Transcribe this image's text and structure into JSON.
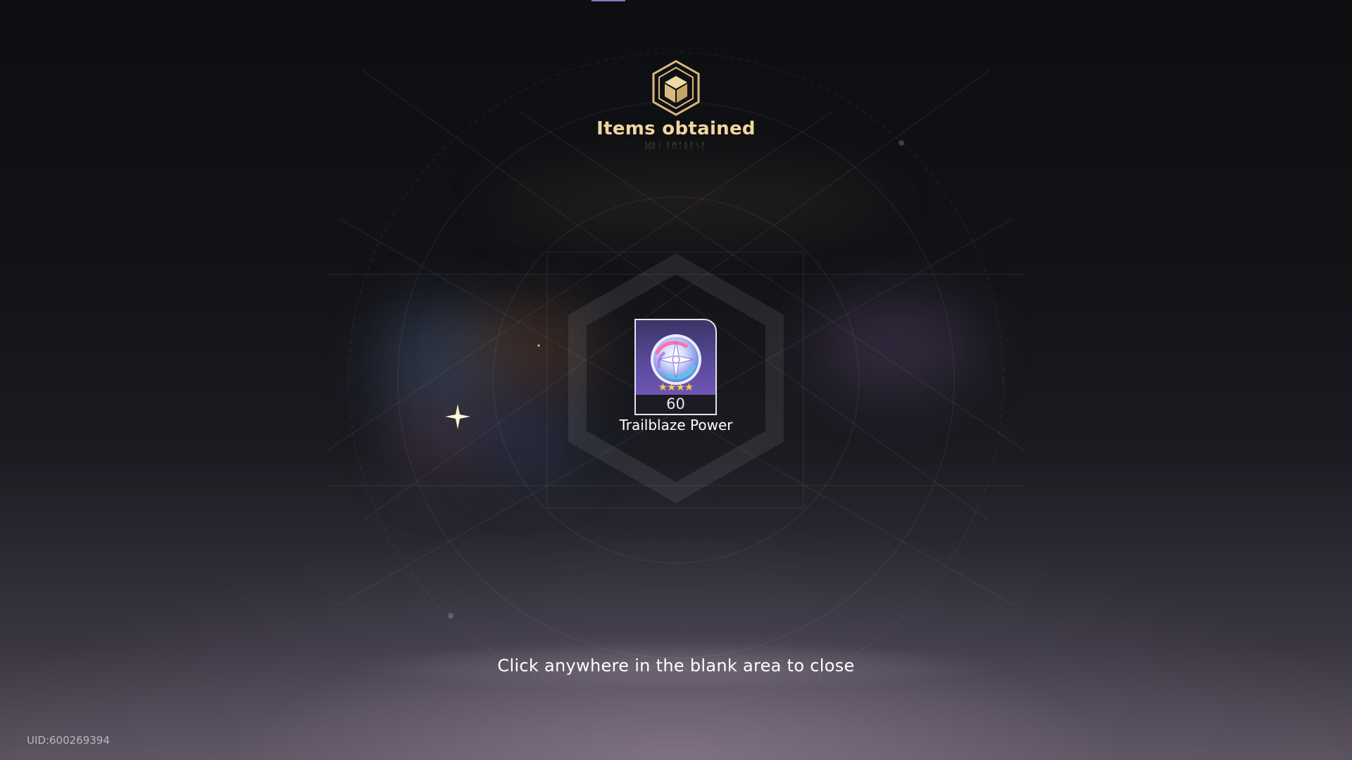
{
  "header": {
    "icon": "item-box-icon",
    "title": "Items obtained",
    "subtitle": "ᛞᚱᛁ ᚨᛗᛏᚱᚨᛊᚨ"
  },
  "item": {
    "name": "Trailblaze Power",
    "quantity": "60",
    "rarity_stars": 4,
    "stars_text": "★★★★",
    "icon": "trailblaze-power-icon"
  },
  "close_hint": "Click anywhere in the blank area to close",
  "uid": "UID:600269394",
  "colors": {
    "title": "#f0d7a0",
    "card_border": "#e6e2f0",
    "card_bg": "#5a4a9a",
    "star": "#f6c94a",
    "accent": "#8a74c9"
  }
}
